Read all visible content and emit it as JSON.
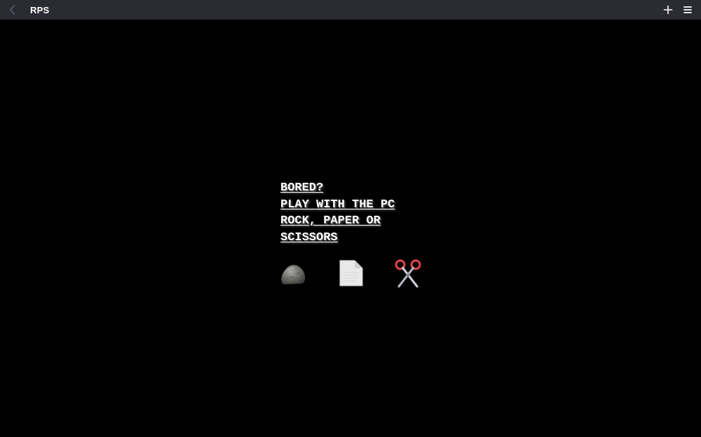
{
  "window": {
    "title": "RPS"
  },
  "toolbar": {
    "back_icon": "chevron-left-icon",
    "add_icon": "plus-icon",
    "menu_icon": "hamburger-menu-icon"
  },
  "game": {
    "headline_lines": [
      "BORED?",
      "PLAY WITH THE PC",
      "ROCK, PAPER OR",
      "SCISSORS"
    ],
    "choices": [
      {
        "id": "rock",
        "icon": "rock-icon"
      },
      {
        "id": "paper",
        "icon": "paper-icon"
      },
      {
        "id": "scissors",
        "icon": "scissors-icon"
      }
    ]
  },
  "colors": {
    "background": "#000000",
    "titlebar": "#2b2c33",
    "text": "#ffffff"
  }
}
